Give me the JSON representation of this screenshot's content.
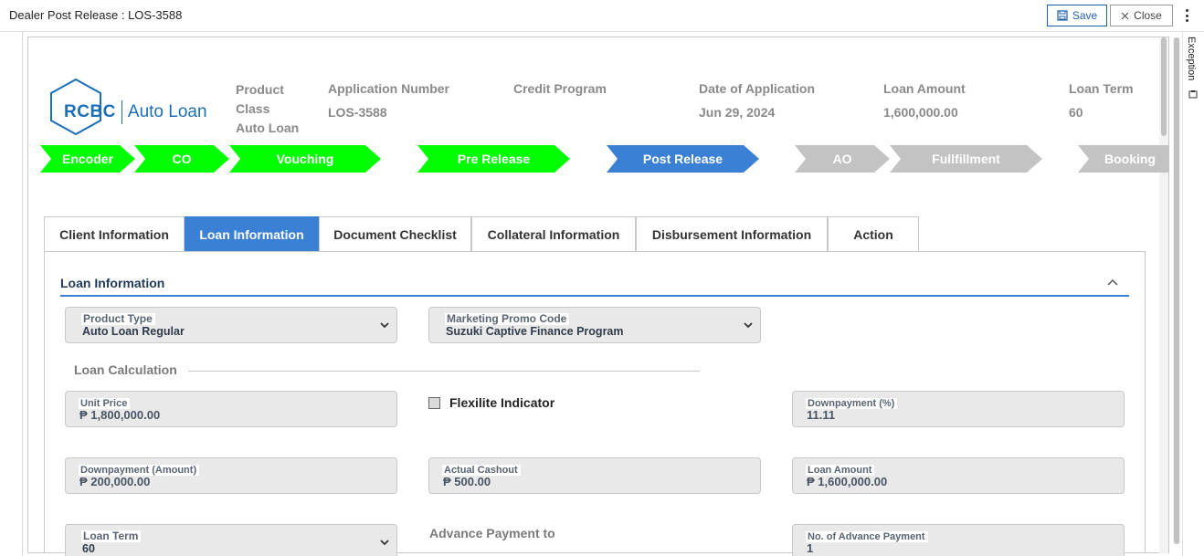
{
  "window": {
    "title": "Dealer Post Release : LOS-3588",
    "save_label": "Save",
    "close_label": "Close",
    "side_tab": "Exception"
  },
  "logo": {
    "brand": "RCBC",
    "product": "Auto Loan",
    "color": "#1c6fb7"
  },
  "header": {
    "product_class_label": "Product Class",
    "product_class_value": "Auto Loan",
    "application_number_label": "Application Number",
    "application_number_value": "LOS-3588",
    "credit_program_label": "Credit Program",
    "credit_program_value": "",
    "date_label": "Date of Application",
    "date_value": "Jun 29, 2024",
    "loan_amount_label": "Loan Amount",
    "loan_amount_value": "1,600,000.00",
    "loan_term_label": "Loan Term",
    "loan_term_value": "60"
  },
  "stepper": [
    {
      "label": "Encoder",
      "status": "done"
    },
    {
      "label": "CO",
      "status": "done"
    },
    {
      "label": "Vouching",
      "status": "done"
    },
    {
      "label": "Pre Release",
      "status": "done"
    },
    {
      "label": "Post Release",
      "status": "active"
    },
    {
      "label": "AO",
      "status": "pending"
    },
    {
      "label": "Fullfillment",
      "status": "pending"
    },
    {
      "label": "Booking",
      "status": "pending"
    }
  ],
  "colors": {
    "done": "#00ff00",
    "active": "#3a80d4",
    "pending": "#c3c3c3"
  },
  "tabs": [
    {
      "label": "Client Information"
    },
    {
      "label": "Loan Information"
    },
    {
      "label": "Document Checklist"
    },
    {
      "label": "Collateral Information"
    },
    {
      "label": "Disbursement Information"
    },
    {
      "label": "Action"
    }
  ],
  "active_tab": "Loan Information",
  "section": {
    "title": "Loan Information",
    "product_type": {
      "label": "Product Type",
      "value": "Auto Loan Regular"
    },
    "promo_code": {
      "label": "Marketing Promo Code",
      "value": "Suzuki Captive Finance Program"
    },
    "calc_title": "Loan Calculation",
    "unit_price": {
      "label": "Unit Price",
      "value": "₱ 1,800,000.00"
    },
    "flexilite": {
      "label": "Flexilite Indicator",
      "checked": false
    },
    "dp_percent": {
      "label": "Downpayment (%)",
      "value": "11.11"
    },
    "dp_amount": {
      "label": "Downpayment (Amount)",
      "value": "₱ 200,000.00"
    },
    "actual_cashout": {
      "label": "Actual Cashout",
      "value": "₱ 500.00"
    },
    "loan_amount": {
      "label": "Loan Amount",
      "value": "₱ 1,600,000.00"
    },
    "loan_term": {
      "label": "Loan Term",
      "value": "60"
    },
    "advance_payment_title": "Advance Payment to",
    "no_advance_payment": {
      "label": "No. of Advance Payment",
      "value": "1"
    }
  }
}
